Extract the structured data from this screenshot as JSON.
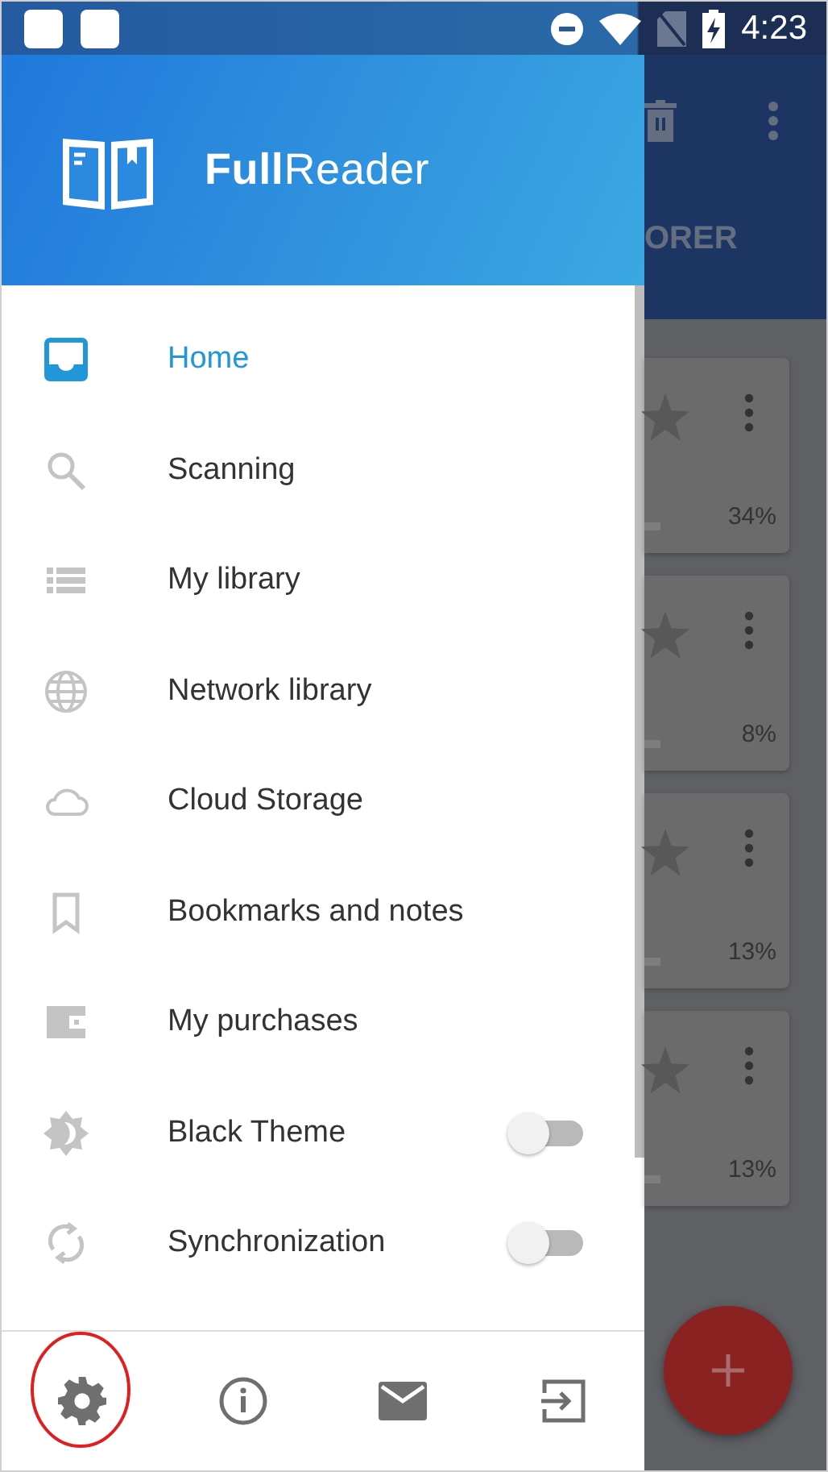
{
  "status_bar": {
    "time": "4:23"
  },
  "drawer": {
    "app_name": "**Full**Reader",
    "items": [
      {
        "label": "Home",
        "kind": "nav",
        "selected": true
      },
      {
        "label": "Scanning",
        "kind": "nav",
        "selected": false
      },
      {
        "label": "My library",
        "kind": "nav",
        "selected": false
      },
      {
        "label": "Network library",
        "kind": "nav",
        "selected": false
      },
      {
        "label": "Cloud Storage",
        "kind": "nav",
        "selected": false
      },
      {
        "label": "Bookmarks and notes",
        "kind": "nav",
        "selected": false
      },
      {
        "label": "My purchases",
        "kind": "nav",
        "selected": false
      },
      {
        "label": "Black Theme",
        "kind": "toggle",
        "on": false
      },
      {
        "label": "Synchronization",
        "kind": "toggle",
        "on": false
      }
    ]
  },
  "background_app": {
    "tab_label": "ORER",
    "books": [
      {
        "progress": "34%"
      },
      {
        "progress": "8%"
      },
      {
        "progress": "13%"
      },
      {
        "progress": "13%"
      }
    ]
  }
}
